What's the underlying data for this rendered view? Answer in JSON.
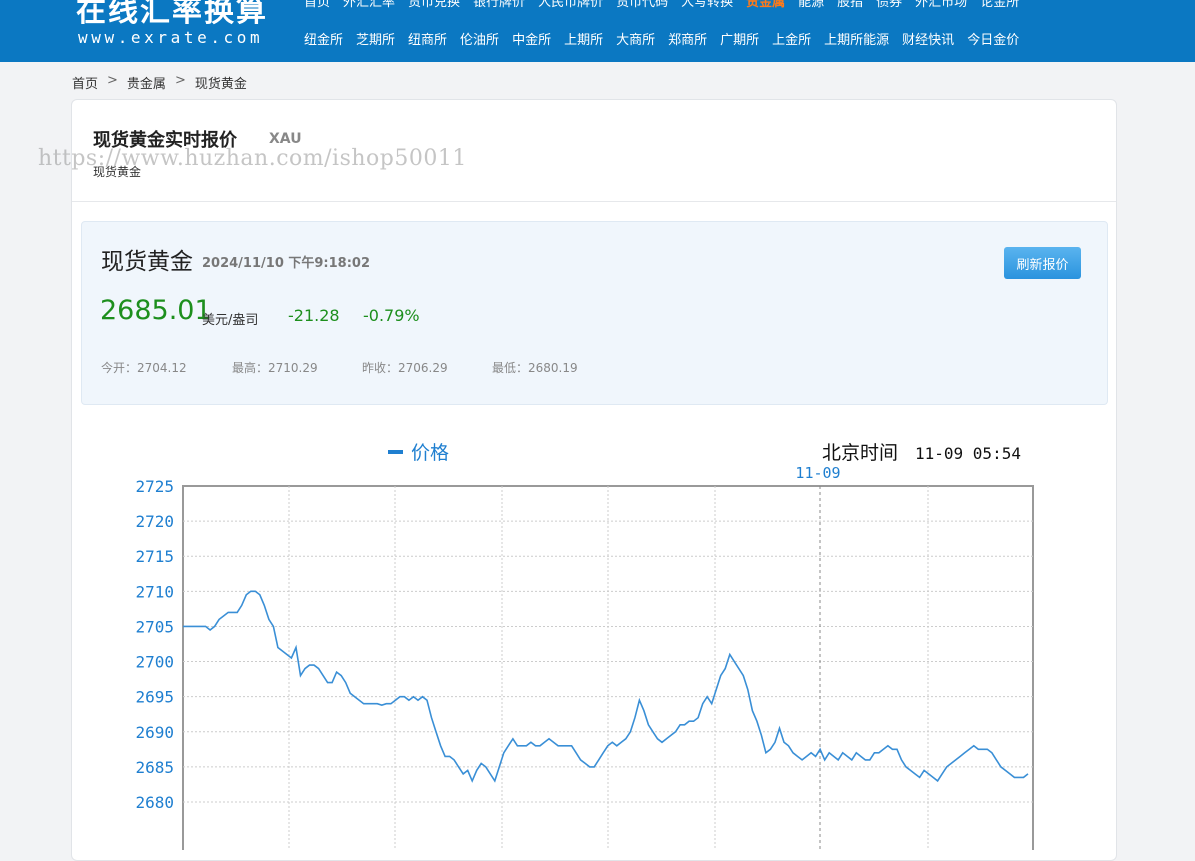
{
  "logo": {
    "cn": "在线汇率换算",
    "en": "www.exrate.com"
  },
  "nav": {
    "row1": [
      "首页",
      "外汇汇率",
      "货币兑换",
      "银行牌价",
      "人民币牌价",
      "货币代码",
      "人写转换",
      "贵金属",
      "能源",
      "股指",
      "债券",
      "外汇市场",
      "论金所"
    ],
    "active_index": 7,
    "row2": [
      "纽金所",
      "芝期所",
      "纽商所",
      "伦油所",
      "中金所",
      "上期所",
      "大商所",
      "郑商所",
      "广期所",
      "上金所",
      "上期所能源",
      "财经快讯",
      "今日金价"
    ]
  },
  "breadcrumb": [
    "首页",
    "贵金属",
    "现货黄金"
  ],
  "breadcrumb_sep": ">",
  "card": {
    "title": "现货黄金实时报价",
    "code": "XAU",
    "subtitle": "现货黄金"
  },
  "watermark": "https://www.huzhan.com/ishop50011",
  "quote": {
    "name": "现货黄金",
    "time": "2024/11/10 下午9:18:02",
    "price": "2685.01",
    "unit": "美元/盎司",
    "change": "-21.28",
    "change_pct": "-0.79%",
    "refresh_label": "刷新报价",
    "stats": {
      "open": "今开：2704.12",
      "high": "最高：2710.29",
      "prev": "昨收：2706.29",
      "low": "最低：2680.19"
    }
  },
  "colors": {
    "header": "#0b78c2",
    "active_nav": "#ff7a1a",
    "price_green": "#1d8f1d",
    "line": "#3a8fd6"
  },
  "chart_data": {
    "type": "line",
    "legend": "价格",
    "clock_label": "北京时间",
    "clock_time": "11-09 05:54",
    "day_marker": "11-09",
    "ylim": [
      2680,
      2725
    ],
    "yticks": [
      2725,
      2720,
      2715,
      2710,
      2705,
      2700,
      2695,
      2690,
      2685,
      2680
    ],
    "grid": true,
    "series": [
      {
        "values": [
          2705,
          2705,
          2705,
          2705,
          2705,
          2705,
          2704.5,
          2705,
          2706,
          2706.5,
          2707,
          2707,
          2707,
          2708,
          2709.5,
          2710,
          2710,
          2709.5,
          2708,
          2706,
          2705,
          2702,
          2701.5,
          2701,
          2700.5,
          2702,
          2698,
          2699,
          2699.5,
          2699.5,
          2699,
          2698,
          2697,
          2697,
          2698.5,
          2698,
          2697,
          2695.5,
          2695,
          2694.5,
          2694,
          2694,
          2694,
          2694,
          2693.8,
          2694,
          2694,
          2694.5,
          2695,
          2695,
          2694.5,
          2695,
          2694.5,
          2695,
          2694.5,
          2692,
          2690,
          2688,
          2686.5,
          2686.5,
          2686,
          2685,
          2684,
          2684.5,
          2683,
          2684.5,
          2685.5,
          2685,
          2684,
          2683,
          2685,
          2687,
          2688,
          2689,
          2688,
          2688,
          2688,
          2688.5,
          2688,
          2688,
          2688.5,
          2689,
          2688.5,
          2688,
          2688,
          2688,
          2688,
          2687,
          2686,
          2685.5,
          2685,
          2685,
          2686,
          2687,
          2688,
          2688.5,
          2688,
          2688.5,
          2689,
          2690,
          2692,
          2694.5,
          2693,
          2691,
          2690,
          2689,
          2688.5,
          2689,
          2689.5,
          2690,
          2691,
          2691,
          2691.5,
          2691.5,
          2692,
          2694,
          2695,
          2694,
          2696,
          2698,
          2699,
          2701,
          2700,
          2699,
          2698,
          2696,
          2693,
          2691.5,
          2689.5,
          2687,
          2687.5,
          2688.5,
          2690.5,
          2688.5,
          2688,
          2687,
          2686.5,
          2686,
          2686.5,
          2687,
          2686.5,
          2687.5,
          2686,
          2687,
          2686.5,
          2686,
          2687,
          2686.5,
          2686,
          2687,
          2686.5,
          2686,
          2686,
          2687,
          2687,
          2687.5,
          2688,
          2687.5,
          2687.5,
          2686,
          2685,
          2684.5,
          2684,
          2683.5,
          2684.5,
          2684,
          2683.5,
          2683,
          2684,
          2685,
          2685.5,
          2686,
          2686.5,
          2687,
          2687.5,
          2688,
          2687.5,
          2687.5,
          2687.5,
          2687,
          2686,
          2685,
          2684.5,
          2684,
          2683.5,
          2683.5,
          2683.5,
          2684
        ]
      }
    ]
  }
}
